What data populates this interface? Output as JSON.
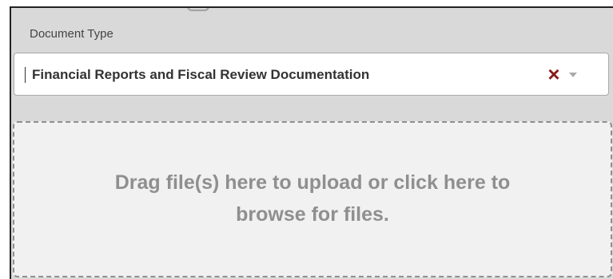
{
  "document_type": {
    "label": "Document Type",
    "selected_value": "Financial Reports and Fiscal Review Documentation",
    "clear_icon": "×",
    "dropdown_icon": "chevron-down-icon"
  },
  "upload": {
    "line1": "Drag file(s) here to upload or click here to",
    "line2": "browse for files."
  },
  "colors": {
    "panel_background": "#d9d9d9",
    "clear_icon": "#8b1a1a",
    "dropzone_text": "#8f8f8f"
  }
}
